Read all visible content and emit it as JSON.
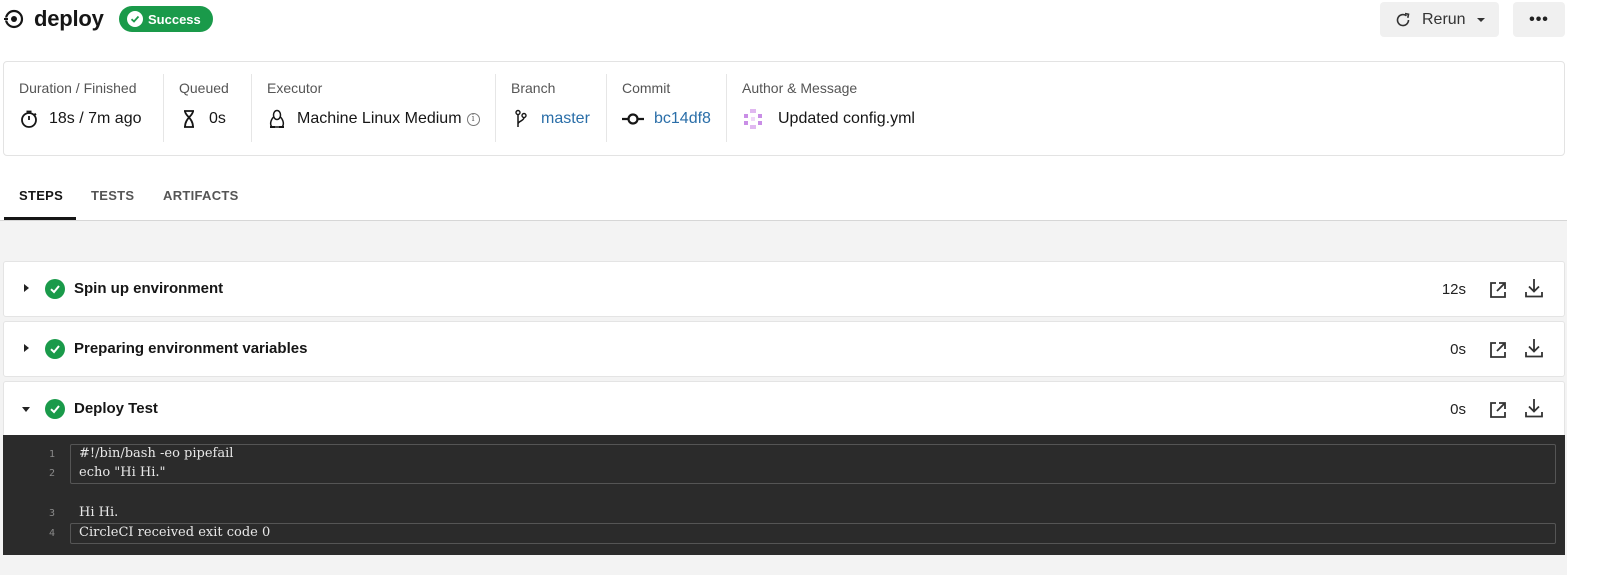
{
  "header": {
    "title": "deploy",
    "status": "Success",
    "rerun_label": "Rerun",
    "more_label": "•••"
  },
  "info": {
    "duration": {
      "label": "Duration / Finished",
      "value": "18s / 7m ago"
    },
    "queued": {
      "label": "Queued",
      "value": "0s"
    },
    "executor": {
      "label": "Executor",
      "value": "Machine Linux Medium",
      "info_glyph": "i"
    },
    "branch": {
      "label": "Branch",
      "value": "master"
    },
    "commit": {
      "label": "Commit",
      "value": "bc14df8"
    },
    "author": {
      "label": "Author & Message",
      "value": "Updated config.yml"
    }
  },
  "tabs": [
    {
      "label": "STEPS",
      "active": true
    },
    {
      "label": "TESTS",
      "active": false
    },
    {
      "label": "ARTIFACTS",
      "active": false
    }
  ],
  "steps": [
    {
      "name": "Spin up environment",
      "duration": "12s",
      "expanded": false
    },
    {
      "name": "Preparing environment variables",
      "duration": "0s",
      "expanded": false
    },
    {
      "name": "Deploy Test",
      "duration": "0s",
      "expanded": true
    }
  ],
  "terminal": {
    "lines": [
      {
        "num": "1",
        "text": "#!/bin/bash -eo pipefail"
      },
      {
        "num": "2",
        "text": "echo \"Hi Hi.\""
      },
      {
        "num": "3",
        "text": "Hi Hi."
      },
      {
        "num": "4",
        "text": "CircleCI received exit code 0"
      }
    ]
  },
  "colors": {
    "success": "#1a9a4a",
    "link": "#2a6ea8",
    "terminal_bg": "#2b2b2b"
  }
}
